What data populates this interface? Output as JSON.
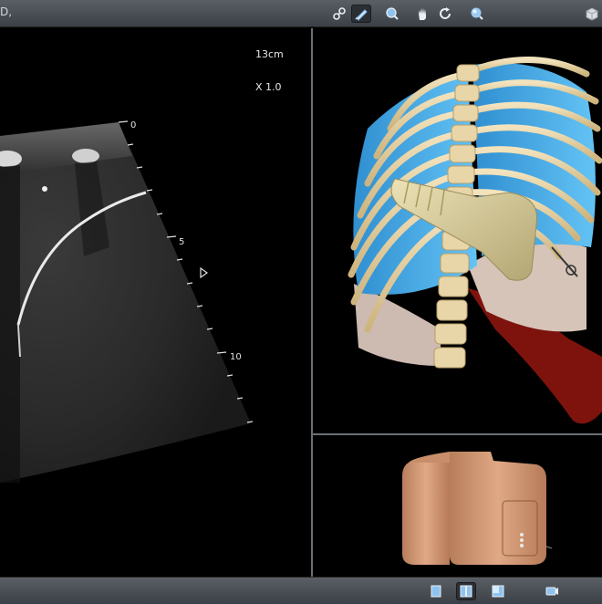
{
  "app": {
    "logo_text": "D,"
  },
  "toolbar_top": {
    "buttons": [
      {
        "name": "link-icon"
      },
      {
        "name": "probe-icon",
        "active": true
      },
      {
        "name": "zoom-icon"
      },
      {
        "name": "pan-hand-icon"
      },
      {
        "name": "rotate-icon"
      },
      {
        "name": "sphere-icon"
      },
      {
        "name": "cube-view-icon"
      }
    ]
  },
  "ultrasound": {
    "depth": "13cm",
    "zoom": "X 1.0",
    "depth_marks": [
      "0",
      "5",
      "10"
    ]
  },
  "toolbar_bottom": {
    "buttons": [
      {
        "name": "single-view-icon"
      },
      {
        "name": "dual-view-icon",
        "active": true
      },
      {
        "name": "layout-view-icon"
      },
      {
        "name": "camera-icon"
      }
    ]
  },
  "colors": {
    "toolbar": "#4a4f56",
    "bone": "#e6d2a6",
    "lung": "#3aa9e6",
    "heart": "#8b1a12",
    "probe": "#ccc08e",
    "skin": "#d9a07c"
  }
}
